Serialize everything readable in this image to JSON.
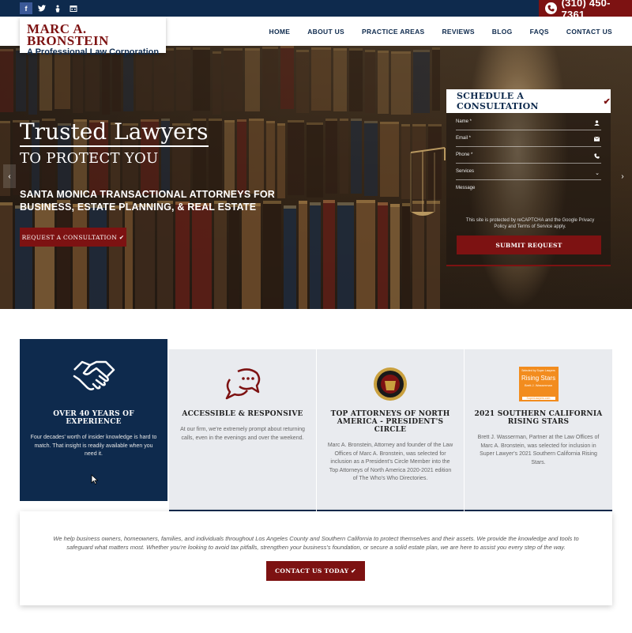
{
  "topbar": {
    "social": [
      {
        "icon": "facebook-icon",
        "glyph": "f"
      },
      {
        "icon": "twitter-icon",
        "glyph": "t"
      },
      {
        "icon": "yelp-icon",
        "glyph": "y"
      },
      {
        "icon": "building-icon",
        "glyph": "▦"
      }
    ],
    "phone": "(310) 450-7361"
  },
  "logo": {
    "name": "MARC A. BRONSTEIN",
    "tagline": "A Professional Law Corporation"
  },
  "nav": {
    "items": [
      "HOME",
      "ABOUT US",
      "PRACTICE AREAS",
      "REVIEWS",
      "BLOG",
      "FAQS",
      "CONTACT US"
    ]
  },
  "hero": {
    "title": "Trusted Lawyers",
    "subtitle": "TO PROTECT YOU",
    "line": "SANTA MONICA TRANSACTIONAL ATTORNEYS FOR BUSINESS, ESTATE PLANNING, & REAL ESTATE",
    "button": "REQUEST A CONSULTATION"
  },
  "form": {
    "title": "SCHEDULE A CONSULTATION",
    "fields": {
      "name": "Name *",
      "email": "Email *",
      "phone": "Phone *",
      "services": "Services",
      "message": "Message"
    },
    "recaptcha": "This site is protected by reCAPTCHA and the Google Privacy Policy and Terms of Service apply.",
    "submit": "SUBMIT REQUEST"
  },
  "features": [
    {
      "title": "OVER 40 YEARS OF EXPERIENCE",
      "desc": "Four decades' worth of insider knowledge is hard to match. That insight is readily available when you need it."
    },
    {
      "title": "ACCESSIBLE & RESPONSIVE",
      "desc": "At our firm, we're extremely prompt about returning calls, even in the evenings and over the weekend."
    },
    {
      "title": "TOP ATTORNEYS OF NORTH AMERICA - PRESIDENT'S CIRCLE",
      "desc": "Marc A. Bronstein, Attorney and founder of the Law Offices of Marc A. Bronstein, was selected for inclusion as a President's Circle Member into the Top Attorneys of North America 2020-2021 edition of The Who's Who Directories."
    },
    {
      "title": "2021 SOUTHERN CALIFORNIA RISING STARS",
      "desc": "Brett J. Wasserman, Partner at the Law Offices of Marc A. Bronstein, was selected for inclusion in Super Lawyer's 2021 Southern California Rising Stars.",
      "badge": {
        "top": "Selected by Super Lawyers",
        "main": "Rising Stars",
        "name": "Brett J. Wasserman",
        "site": "SuperLawyers.com"
      }
    }
  ],
  "intro": {
    "text": "We help business owners, homeowners, families, and individuals throughout Los Angeles County and Southern California to protect themselves and their assets. We provide the knowledge and tools to safeguard what matters most. Whether you're looking to avoid tax pitfalls, strengthen your business's foundation, or secure a solid estate plan, we are here to assist you every step of the way.",
    "button": "CONTACT US TODAY"
  },
  "colors": {
    "navy": "#0e2a4d",
    "maroon": "#7d1212",
    "card_bg": "#e9ebef",
    "badge_orange": "#f28c1e"
  }
}
